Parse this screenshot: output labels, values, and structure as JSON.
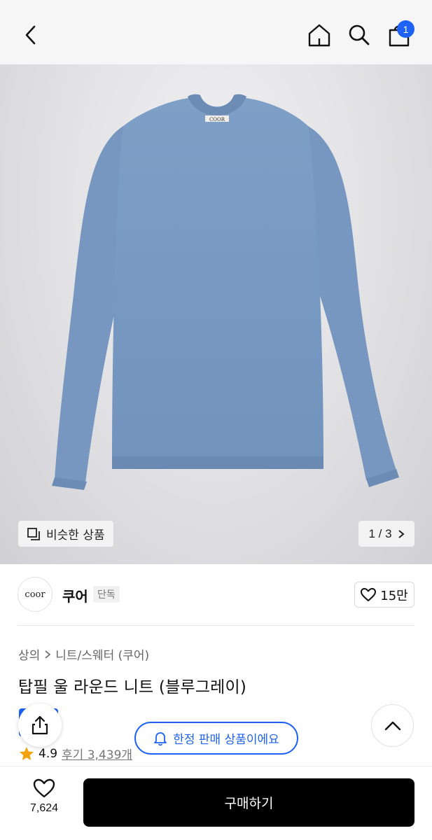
{
  "header": {
    "back_icon": "chevron-left-icon",
    "home_icon": "home-icon",
    "search_icon": "search-icon",
    "cart_icon": "shopping-bag-icon",
    "cart_count": "1",
    "accent_color": "#1e62f5"
  },
  "hero": {
    "label_on_collar": "COOR",
    "similar_label": "비슷한 상품",
    "pager": {
      "text": "1 / 3"
    }
  },
  "brand": {
    "logo_text": "coor",
    "name": "쿠어",
    "tag": "단독",
    "like_count": "15만"
  },
  "product": {
    "crumbs": [
      "상의",
      "니트/스웨터 (쿠어)"
    ],
    "title": "탑필 울 라운드 니트 (블루그레이)",
    "rating": "4.9",
    "review_text": "후기 3,439개"
  },
  "floating": {
    "limited_label": "한정 판매 상품이에요"
  },
  "bottom": {
    "wish_count": "7,624",
    "buy_label": "구매하기"
  }
}
